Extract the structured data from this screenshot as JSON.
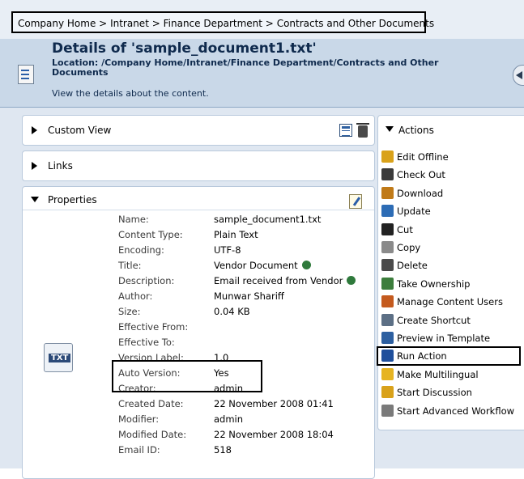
{
  "breadcrumb": [
    "Company Home",
    "Intranet",
    "Finance Department",
    "Contracts and Other Documents"
  ],
  "breadcrumb_separator": ">",
  "header": {
    "title": "Details of 'sample_document1.txt'",
    "location": "Location: /Company Home/Intranet/Finance Department/Contracts and Other Documents",
    "subtitle": "View the details about the content."
  },
  "panels": {
    "custom_view": "Custom View",
    "links": "Links",
    "properties": "Properties",
    "actions": "Actions"
  },
  "properties": [
    {
      "label": "Name:",
      "value": "sample_document1.txt"
    },
    {
      "label": "Content Type:",
      "value": "Plain Text"
    },
    {
      "label": "Encoding:",
      "value": "UTF-8"
    },
    {
      "label": "Title:",
      "value": "Vendor Document"
    },
    {
      "label": "Description:",
      "value": "Email received from Vendor"
    },
    {
      "label": "Author:",
      "value": "Munwar Shariff"
    },
    {
      "label": "Size:",
      "value": "0.04 KB"
    },
    {
      "label": "Effective From:",
      "value": ""
    },
    {
      "label": "Effective To:",
      "value": ""
    },
    {
      "label": "Version Label:",
      "value": "1.0"
    },
    {
      "label": "Auto Version:",
      "value": "Yes"
    },
    {
      "label": "Creator:",
      "value": "admin"
    },
    {
      "label": "Created Date:",
      "value": "22 November 2008 01:41"
    },
    {
      "label": "Modifier:",
      "value": "admin"
    },
    {
      "label": "Modified Date:",
      "value": "22 November 2008 18:04"
    },
    {
      "label": "Email ID:",
      "value": "518"
    }
  ],
  "file_type_icon_text": "TXT",
  "actions": [
    {
      "label": "Edit Offline",
      "icon": "pencil-icon",
      "color": "#d9a21b"
    },
    {
      "label": "Check Out",
      "icon": "check-out-icon",
      "color": "#3a3a3a"
    },
    {
      "label": "Download",
      "icon": "download-icon",
      "color": "#c07a18"
    },
    {
      "label": "Update",
      "icon": "update-icon",
      "color": "#2d6cb5"
    },
    {
      "label": "Cut",
      "icon": "scissors-icon",
      "color": "#222222"
    },
    {
      "label": "Copy",
      "icon": "copy-icon",
      "color": "#8a8a8a"
    },
    {
      "label": "Delete",
      "icon": "trash-icon",
      "color": "#4a4a4a"
    },
    {
      "label": "Take Ownership",
      "icon": "ownership-icon",
      "color": "#3c7d3c"
    },
    {
      "label": "Manage Content Users",
      "icon": "users-icon",
      "color": "#c45a1e"
    },
    {
      "label": "Create Shortcut",
      "icon": "shortcut-icon",
      "color": "#5c6f85"
    },
    {
      "label": "Preview in Template",
      "icon": "preview-icon",
      "color": "#2d5fa0"
    },
    {
      "label": "Run Action",
      "icon": "run-action-icon",
      "color": "#1f4f9c"
    },
    {
      "label": "Make Multilingual",
      "icon": "multilingual-icon",
      "color": "#e6b422"
    },
    {
      "label": "Start Discussion",
      "icon": "discussion-icon",
      "color": "#d9a21b"
    },
    {
      "label": "Start Advanced Workflow",
      "icon": "workflow-icon",
      "color": "#7a7a7a"
    }
  ]
}
